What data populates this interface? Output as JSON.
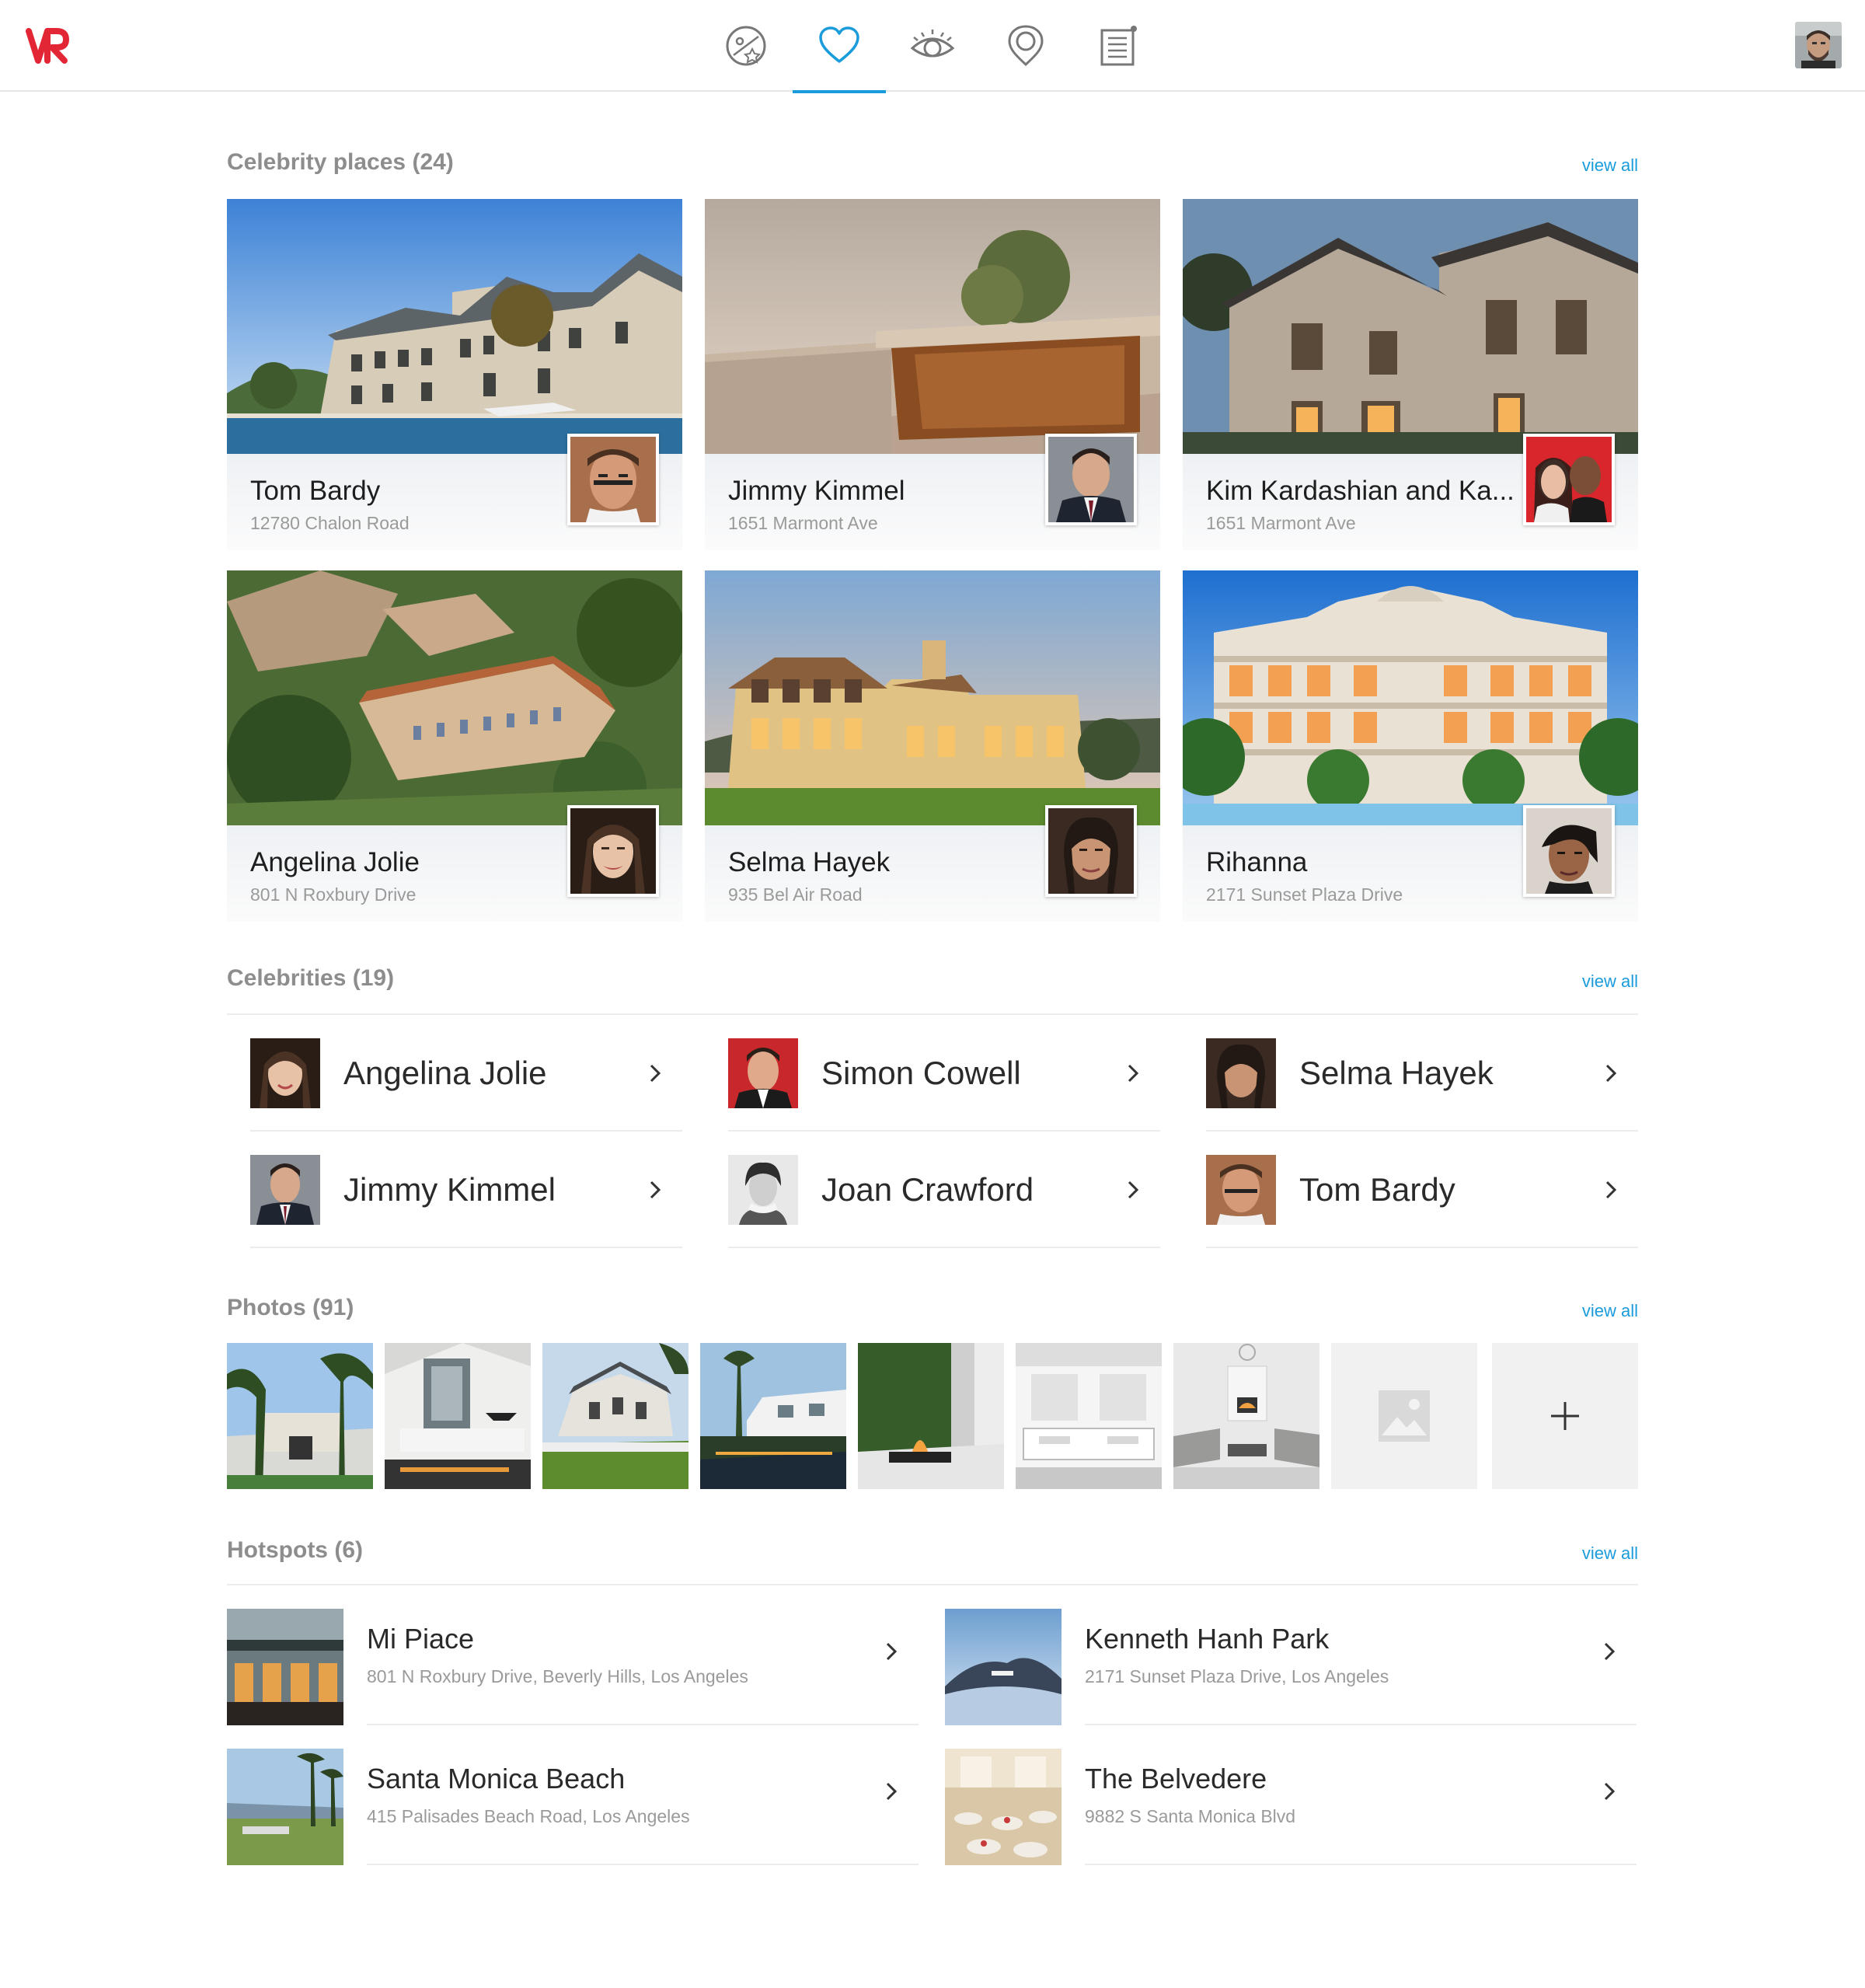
{
  "app": {
    "logo_text": "VR"
  },
  "nav": {
    "icons": [
      "explore-icon",
      "heart-icon",
      "eye-icon",
      "location-pin-icon",
      "notes-icon"
    ],
    "active_index": 1
  },
  "colors": {
    "accent": "#1a9bdc",
    "brand": "#e32635",
    "muted_text": "#9a9a9a"
  },
  "celebrity_places": {
    "title": "Celebrity places (24)",
    "view_all": "view all",
    "items": [
      {
        "name": "Tom Bardy",
        "address": "12780 Chalon Road"
      },
      {
        "name": "Jimmy Kimmel",
        "address": "1651 Marmont Ave"
      },
      {
        "name": "Kim Kardashian and Ka...",
        "address": "1651 Marmont Ave"
      },
      {
        "name": "Angelina Jolie",
        "address": "801 N Roxbury Drive"
      },
      {
        "name": "Selma Hayek",
        "address": "935 Bel Air Road"
      },
      {
        "name": "Rihanna",
        "address": "2171 Sunset Plaza Drive"
      }
    ]
  },
  "celebrities": {
    "title": "Celebrities (19)",
    "view_all": "view all",
    "items": [
      {
        "name": "Angelina Jolie"
      },
      {
        "name": "Simon Cowell"
      },
      {
        "name": "Selma Hayek"
      },
      {
        "name": "Jimmy Kimmel"
      },
      {
        "name": "Joan Crawford"
      },
      {
        "name": "Tom Bardy"
      }
    ]
  },
  "photos": {
    "title": "Photos (91)",
    "view_all": "view all",
    "add_label": "+"
  },
  "hotspots": {
    "title": "Hotspots (6)",
    "view_all": "view all",
    "items": [
      {
        "name": "Mi Piace",
        "address": "801 N Roxbury Drive, Beverly Hills, Los Angeles"
      },
      {
        "name": "Kenneth Hanh Park",
        "address": "2171 Sunset Plaza Drive, Los Angeles"
      },
      {
        "name": "Santa Monica Beach",
        "address": "415 Palisades Beach Road, Los Angeles"
      },
      {
        "name": "The Belvedere",
        "address": "9882 S Santa Monica Blvd"
      }
    ]
  }
}
